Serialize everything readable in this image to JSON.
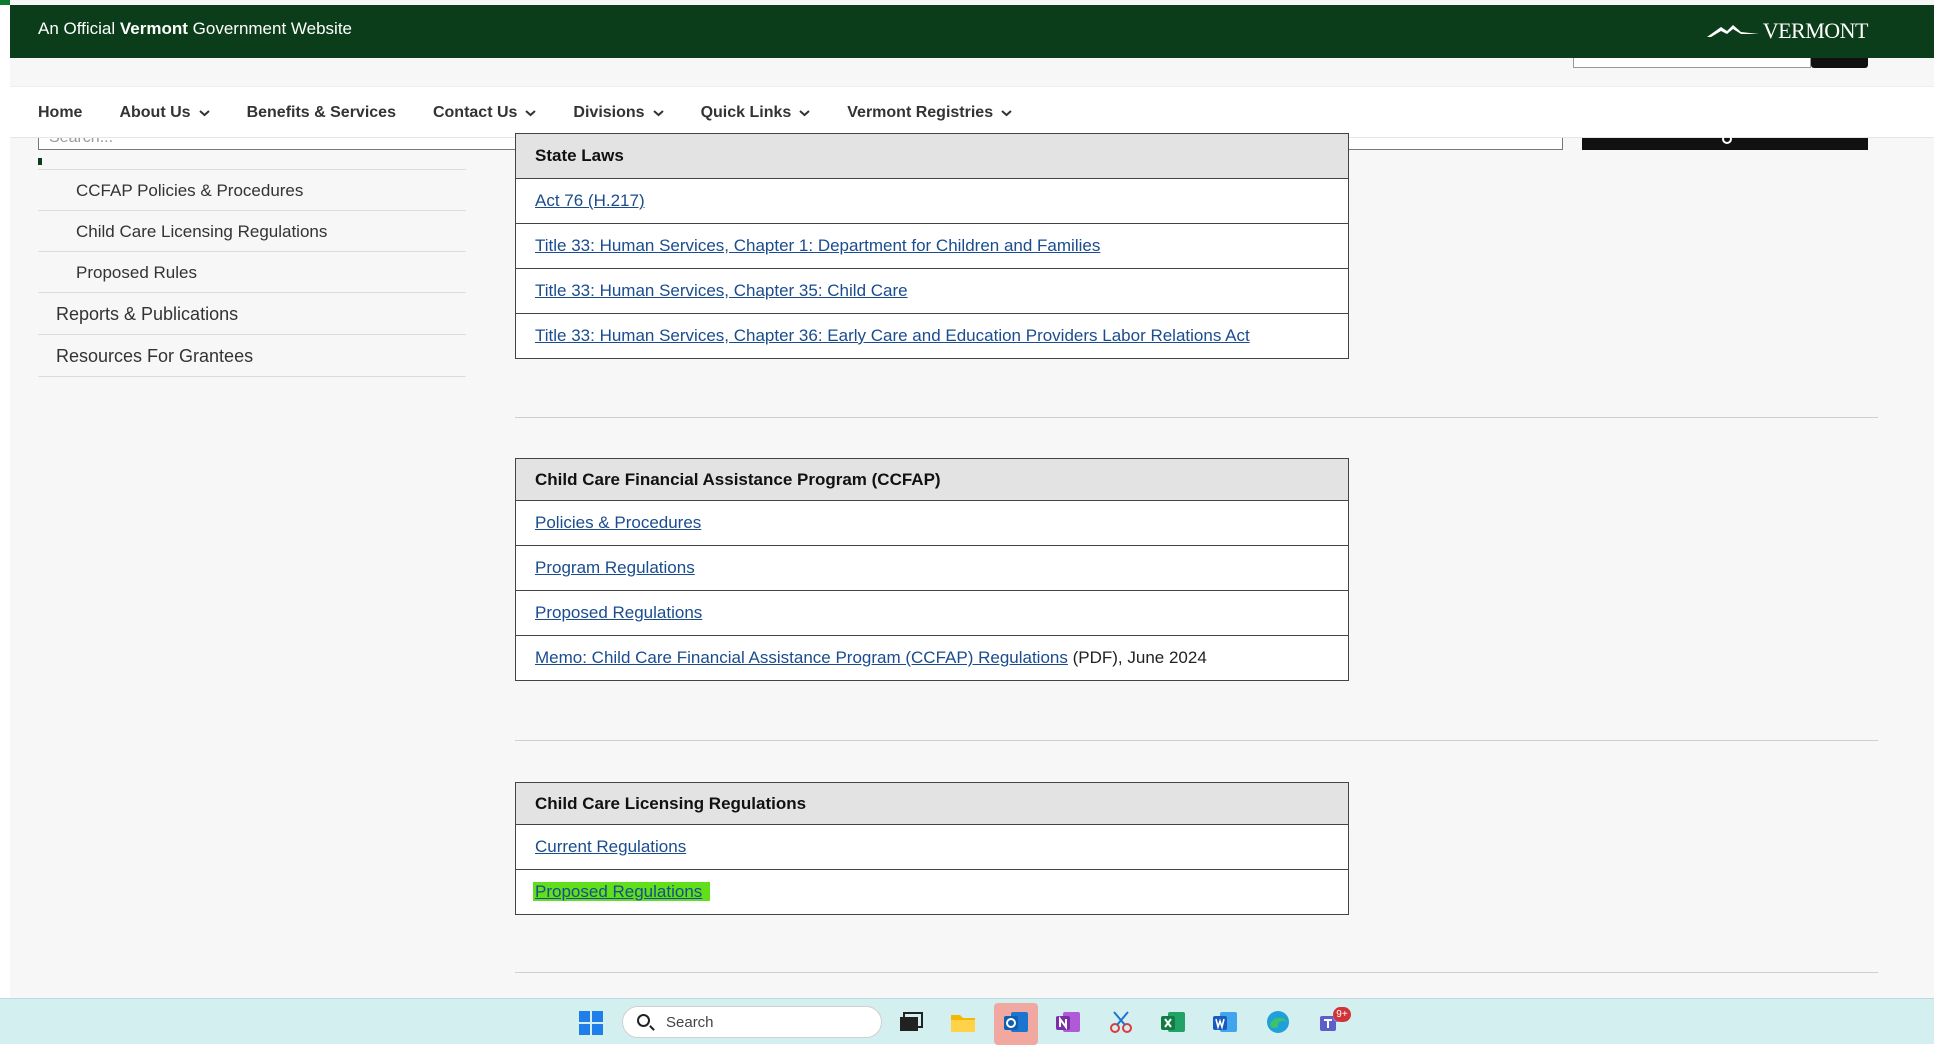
{
  "header": {
    "official_prefix": "An Official ",
    "official_bold": "Vermont",
    "official_suffix": " Government Website",
    "logo_text": "VERMONT"
  },
  "nav": {
    "items": [
      {
        "label": "Home",
        "dropdown": false
      },
      {
        "label": "About Us",
        "dropdown": true
      },
      {
        "label": "Benefits & Services",
        "dropdown": false
      },
      {
        "label": "Contact Us",
        "dropdown": true
      },
      {
        "label": "Divisions",
        "dropdown": true
      },
      {
        "label": "Quick Links",
        "dropdown": true
      },
      {
        "label": "Vermont Registries",
        "dropdown": true
      }
    ],
    "search_placeholder": "Search..."
  },
  "sidebar": {
    "items": [
      {
        "label": "CCFAP Policies & Procedures"
      },
      {
        "label": "Child Care Licensing Regulations"
      },
      {
        "label": "Proposed Rules"
      },
      {
        "label": "Reports & Publications"
      },
      {
        "label": "Resources For Grantees"
      }
    ]
  },
  "state_laws": {
    "header": "State Laws",
    "links": [
      "Act 76 (H.217)",
      "Title 33: Human Services, Chapter 1: Department for Children and Families",
      "Title 33: Human Services, Chapter 35: Child Care",
      "Title 33: Human Services, Chapter 36: Early Care and Education Providers Labor Relations Act"
    ]
  },
  "ccfap": {
    "header": "Child Care Financial Assistance Program (CCFAP)",
    "links": [
      "Policies & Procedures",
      "Program Regulations",
      "Proposed Regulations"
    ],
    "memo_link": "Memo: Child Care Financial Assistance Program (CCFAP) Regulations",
    "memo_suffix": " (PDF), June 2024"
  },
  "licensing": {
    "header": "Child Care Licensing Regulations",
    "links": [
      "Current Regulations",
      "Proposed Regulations"
    ],
    "highlight_color": "#5fe01a"
  },
  "taskbar": {
    "search_label": "Search",
    "teams_badge": "9+"
  },
  "colors": {
    "header_bg": "#0b3d1a",
    "accent_green": "#0c7a2e",
    "link": "#1a4c8f"
  }
}
